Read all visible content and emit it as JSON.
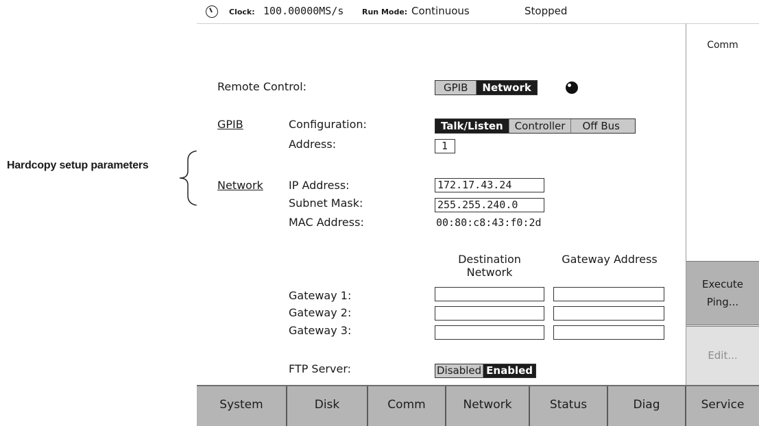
{
  "annotation": {
    "label": "Hardcopy setup parameters"
  },
  "status": {
    "clock_label": "Clock:",
    "clock_value": "100.00000MS/s",
    "run_mode_label": "Run Mode:",
    "run_mode_value": "Continuous",
    "run_state": "Stopped"
  },
  "remote_control": {
    "label": "Remote Control:",
    "options": [
      "GPIB",
      "Network"
    ],
    "selected": "Network"
  },
  "gpib": {
    "section_label": "GPIB",
    "configuration_label": "Configuration:",
    "configuration_options": [
      "Talk/Listen",
      "Controller",
      "Off Bus"
    ],
    "configuration_selected": "Talk/Listen",
    "address_label": "Address:",
    "address_value": "1"
  },
  "network": {
    "section_label": "Network",
    "ip_label": "IP Address:",
    "ip_value": "172.17.43.24",
    "subnet_label": "Subnet Mask:",
    "subnet_value": "255.255.240.0",
    "mac_label": "MAC Address:",
    "mac_value": "00:80:c8:43:f0:2d"
  },
  "gateways": {
    "col_destination": "Destination Network",
    "col_gateway": "Gateway Address",
    "rows": [
      {
        "label": "Gateway 1:",
        "destination": "",
        "address": ""
      },
      {
        "label": "Gateway 2:",
        "destination": "",
        "address": ""
      },
      {
        "label": "Gateway 3:",
        "destination": "",
        "address": ""
      }
    ]
  },
  "ftp": {
    "label": "FTP Server:",
    "options": [
      "Disabled",
      "Enabled"
    ],
    "selected": "Enabled"
  },
  "side_menu": {
    "title": "Comm",
    "execute_ping_line1": "Execute",
    "execute_ping_line2": "Ping...",
    "edit": "Edit..."
  },
  "bottom_menu": [
    "System",
    "Disk",
    "Comm",
    "Network",
    "Status",
    "Diag",
    "Service"
  ],
  "colors": {
    "selected_bg": "#1c1c1c",
    "button_gray": "#b5b5b5",
    "disabled_bg": "#e1e1e1"
  }
}
